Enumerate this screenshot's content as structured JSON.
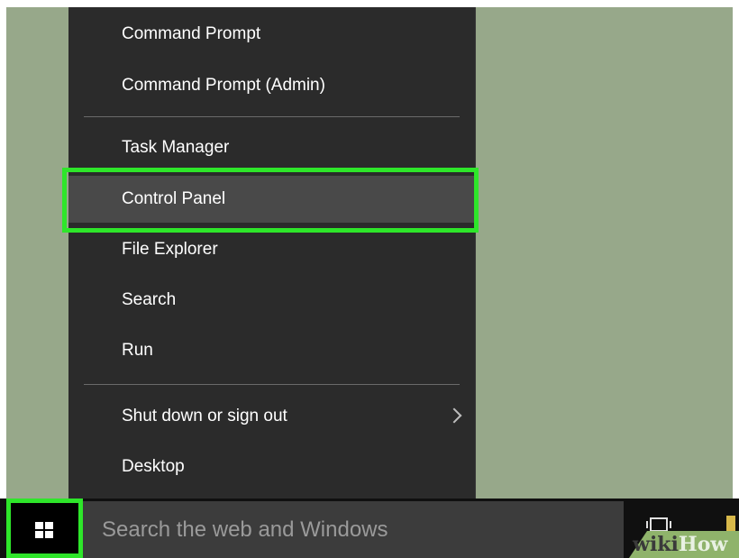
{
  "context_menu": {
    "items": [
      {
        "label": "Command Prompt"
      },
      {
        "label": "Command Prompt (Admin)"
      },
      {
        "label": "Task Manager"
      },
      {
        "label": "Control Panel",
        "highlighted": true
      },
      {
        "label": "File Explorer"
      },
      {
        "label": "Search"
      },
      {
        "label": "Run"
      },
      {
        "label": "Shut down or sign out",
        "submenu": true
      },
      {
        "label": "Desktop"
      }
    ]
  },
  "taskbar": {
    "start_icon": "windows-logo-icon",
    "search_placeholder": "Search the web and Windows",
    "task_view_icon": "task-view-icon"
  },
  "watermark": {
    "wiki": "wiki",
    "how": "How"
  },
  "colors": {
    "desktop": "#97a88a",
    "menu_bg": "#2b2b2b",
    "highlight": "#2ee62a",
    "hover_bg": "#494949"
  }
}
